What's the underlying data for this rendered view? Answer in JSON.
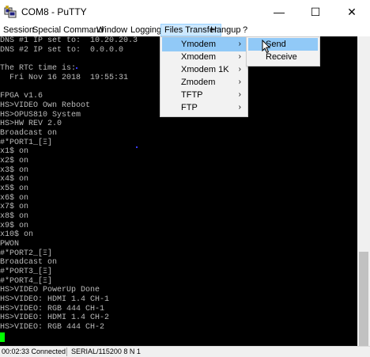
{
  "window": {
    "title": "COM8 - PuTTY",
    "minimize_glyph": "—",
    "maximize_glyph": "☐",
    "close_glyph": "✕"
  },
  "menubar": {
    "items": [
      {
        "label": "Session"
      },
      {
        "label": "Special Command"
      },
      {
        "label": "Window"
      },
      {
        "label": "Logging"
      },
      {
        "label": "Files Transfer"
      },
      {
        "label": "Hangup"
      },
      {
        "label": "?"
      }
    ]
  },
  "files_transfer_menu": {
    "items": [
      {
        "label": "Ymodem",
        "arrow": "›"
      },
      {
        "label": "Xmodem",
        "arrow": "›"
      },
      {
        "label": "Xmodem 1K",
        "arrow": "›"
      },
      {
        "label": "Zmodem",
        "arrow": "›"
      },
      {
        "label": "TFTP",
        "arrow": "›"
      },
      {
        "label": "FTP",
        "arrow": "›"
      }
    ],
    "submenu": [
      {
        "label": "Send"
      },
      {
        "label": "Receive"
      }
    ]
  },
  "terminal": {
    "lines": [
      "DNS #1 IP set to:  10.20.20.3",
      "DNS #2 IP set to:  0.0.0.0",
      "",
      "The RTC time is:",
      "  Fri Nov 16 2018  19:55:31",
      "",
      "FPGA v1.6",
      "HS>VIDEO Own Reboot",
      "HS>OPUS810 System",
      "HS>HW REV 2.0",
      "Broadcast on",
      "#*PORT1_[Ξ]",
      "x1$ on",
      "x2$ on",
      "x3$ on",
      "x4$ on",
      "x5$ on",
      "x6$ on",
      "x7$ on",
      "x8$ on",
      "x9$ on",
      "x10$ on",
      "PWON",
      "#*PORT2_[Ξ]",
      "Broadcast on",
      "#*PORT3_[Ξ]",
      "#*PORT4_[Ξ]",
      "HS>VIDEO PowerUp Done",
      "HS>VIDEO: HDMI 1.4 CH-1",
      "HS>VIDEO: RGB 444 CH-1",
      "HS>VIDEO: HDMI 1.4 CH-2",
      "HS>VIDEO: RGB 444 CH-2"
    ]
  },
  "statusbar": {
    "connected": "00:02:33 Connected",
    "serial": "SERIAL/115200 8 N 1"
  },
  "colors": {
    "terminal_bg": "#000000",
    "terminal_fg": "#bbbbbb",
    "cursor": "#00ff00",
    "menu_highlight": "#91c9f7"
  },
  "icons": {
    "app": "putty-app-icon",
    "mouse": "mouse-pointer-icon"
  }
}
